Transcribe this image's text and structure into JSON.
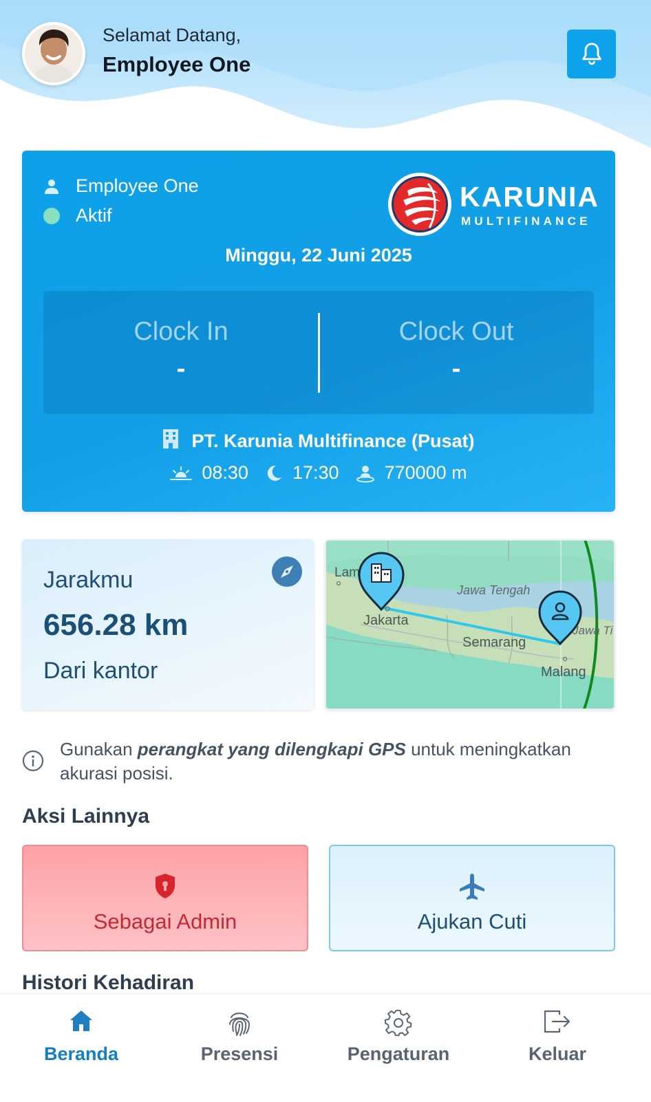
{
  "header": {
    "greeting": "Selamat Datang,",
    "user_name": "Employee One",
    "avatar_icon": "user-avatar",
    "notification_icon": "bell-icon"
  },
  "attendance_card": {
    "employee_name": "Employee One",
    "status": "Aktif",
    "status_color": "#88e0c0",
    "company_logo": {
      "brand": "KARUNIA",
      "tagline": "MULTIFINANCE"
    },
    "date": "Minggu, 22 Juni 2025",
    "clock_in": {
      "label": "Clock In",
      "value": "-"
    },
    "clock_out": {
      "label": "Clock Out",
      "value": "-"
    },
    "office_name": "PT. Karunia Multifinance (Pusat)",
    "shift_start": "08:30",
    "shift_end": "17:30",
    "radius": "770000 m",
    "accent_color": "#0ea2ea"
  },
  "distance_card": {
    "title": "Jarakmu",
    "value": "656.28 km",
    "subtitle": "Dari kantor",
    "icon": "compass-icon"
  },
  "map": {
    "labels": [
      "Lam",
      "Jawa Tengah",
      "Jakarta",
      "Semarang",
      "Jawa Ti",
      "Malang"
    ],
    "office_marker_icon": "office-building-icon",
    "user_marker_icon": "user-location-icon"
  },
  "info": {
    "text_before": "Gunakan ",
    "text_emphasis": "perangkat yang dilengkapi GPS",
    "text_after": " untuk meningkatkan akurasi posisi."
  },
  "other_actions": {
    "title": "Aksi Lainnya",
    "admin_label": "Sebagai Admin",
    "leave_label": "Ajukan Cuti",
    "admin_color": "#c32a33"
  },
  "history": {
    "title": "Histori Kehadiran"
  },
  "bottom_nav": {
    "items": [
      {
        "label": "Beranda",
        "icon": "home-icon",
        "active": true
      },
      {
        "label": "Presensi",
        "icon": "fingerprint-icon",
        "active": false
      },
      {
        "label": "Pengaturan",
        "icon": "gear-icon",
        "active": false
      },
      {
        "label": "Keluar",
        "icon": "logout-icon",
        "active": false
      }
    ]
  }
}
